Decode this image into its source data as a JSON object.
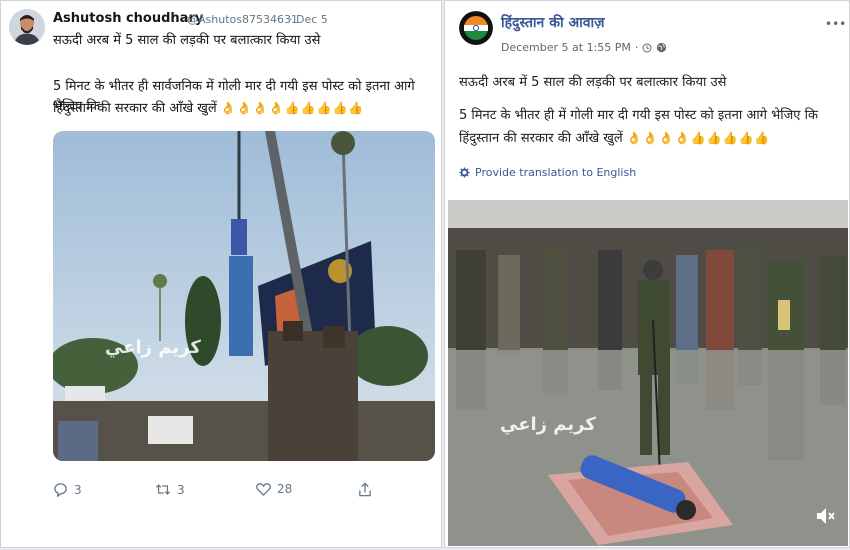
{
  "twitter": {
    "author_name": "Ashutosh choudhary",
    "author_handle": "@Ashutos87534631",
    "date": "· Dec 5",
    "line1": "सऊदी अरब में 5 साल की लड़की पर बलात्कार किया उसे",
    "line2": "5 मिनट के भीतर ही सार्वजनिक में गोली मार दी गयी इस पोस्ट को इतना आगे भेजिए कि",
    "line3": "हिंदुस्तान की सरकार की आँखे खुलें",
    "emojis": "👌👌👌👌👍👍👍👍👍",
    "watermark": "كريم زاعي",
    "reply_count": "3",
    "retweet_count": "3",
    "like_count": "28"
  },
  "facebook": {
    "page_name": "हिंदुस्तान की आवाज़",
    "date": "December 5 at 1:55 PM",
    "line1": "सऊदी अरब में 5 साल की लड़की पर बलात्कार किया उसे",
    "line2": "5 मिनट के भीतर ही में गोली मार दी गयी इस पोस्ट को इतना आगे भेजिए कि",
    "line3": "हिंदुस्तान की सरकार की आँखे खुलें",
    "emojis": "👌👌👌👌👍👍👍👍👍",
    "translate_label": "Provide translation to English",
    "watermark": "كريم زاعي",
    "more_label": "•••"
  },
  "colors": {
    "twitter_text": "#14171a",
    "twitter_meta": "#657786",
    "facebook_link": "#385898"
  }
}
